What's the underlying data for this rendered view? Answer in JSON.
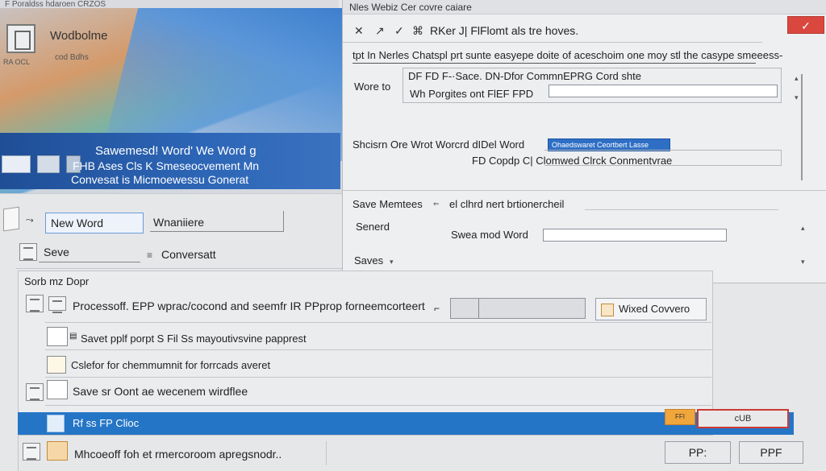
{
  "window": {
    "top_strip": "F Poraldss hdaroen CRZOS",
    "hero_title": "Wodbolme",
    "hero_subtitle": "cod Bdhs",
    "hero_version": "RA OCL",
    "banner_line1": "Sawemesd! Word' We Word g",
    "banner_line2": "FHB Ases Cls K Smeseocvement Mn",
    "banner_line3": "Convesat is Micmoewessu Gonerat"
  },
  "dialog": {
    "title": "Nles Webiz Cer covre caiare",
    "close_glyph": "✓",
    "toolbar": {
      "close": "✕",
      "pin": "↗",
      "check": "✓",
      "save_glyph": "⌘",
      "path": "RKer J| FlFlomt als tre hoves."
    },
    "breadcrumb": "tpt In Nerles Chatspl prt sunte easyepe doite of aceschoim one moy stl the casype smeeess-",
    "word_to_label": "Wore to",
    "word_to_line1": "DF FD F-·Sace. DN-Dfor CommnEPRG Cord shte",
    "word_to_line2": "Wh Porgites ont FlEF FPD",
    "shortcut_label": "Shcisrn Ore Wrot Worcrd dIDel Word",
    "shortcut_selected": "Ohaedswaret Ceortbert Lasse",
    "shortcut_line2": "FD Copdp C| Clomwed Clrck Conmentvrae",
    "save_menus_label": "Save Memtees",
    "save_menus_value": "el clhrd nert brtionercheil",
    "saved_label": "Senerd",
    "saved_field_label": "Swea mod Word",
    "saves_label": "Saves"
  },
  "left_pane": {
    "new_word_button": "New Word",
    "mainframe_label": "Wnaniiere",
    "save_button": "Seve",
    "convert_label": "Conversatt",
    "section_title": "Sorb mz Dopr"
  },
  "list": {
    "row1": "Processoff. EPP wprac/cocond and seemfr IR PPprop forneemcorteert",
    "row1_button": "Wixed Covvero",
    "row2": "Savet pplf porpt S Fil Ss mayoutivsvine papprest",
    "row3": "Cslefor for chemmumnit for forrcads averet",
    "row4": "Save sr Oont ae wecenem wirdflee",
    "row5_selected": "Rf ss FP Clioc",
    "orange_tab": "FFI",
    "red_button": "cUB",
    "row6": "Mhcoeoff foh et rmercoroom apregsnodr.."
  },
  "buttons": {
    "pp_button": "PP:",
    "ppf_button": "PPF"
  },
  "colors": {
    "accent_blue": "#2575c6",
    "banner_blue": "#2d66b7",
    "close_red": "#d9473e",
    "orange": "#f0a63a"
  }
}
